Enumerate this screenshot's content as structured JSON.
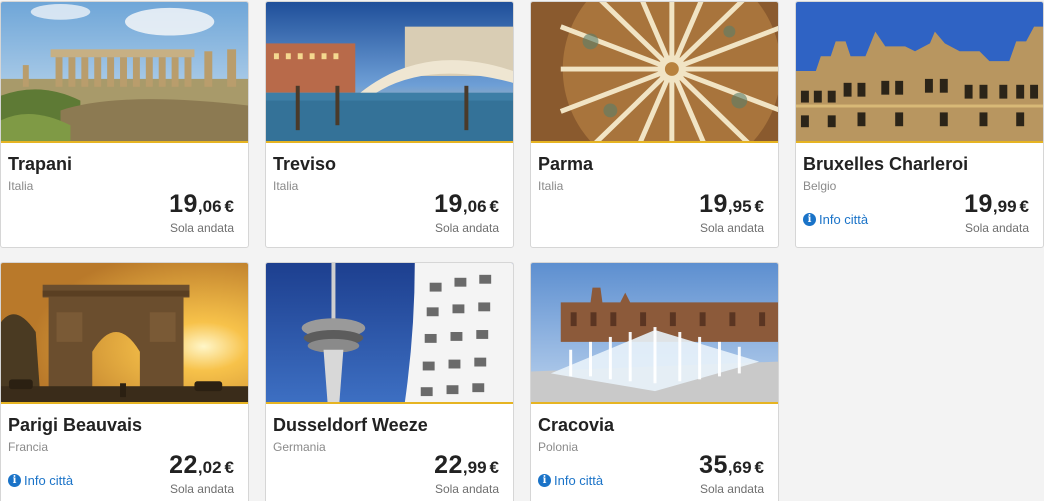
{
  "destinations": [
    {
      "city": "Trapani",
      "country": "Italia",
      "price_int": "19",
      "price_dec": ",06",
      "currency": "€",
      "fare_type": "Sola andata",
      "info": ""
    },
    {
      "city": "Treviso",
      "country": "Italia",
      "price_int": "19",
      "price_dec": ",06",
      "currency": "€",
      "fare_type": "Sola andata",
      "info": ""
    },
    {
      "city": "Parma",
      "country": "Italia",
      "price_int": "19",
      "price_dec": ",95",
      "currency": "€",
      "fare_type": "Sola andata",
      "info": ""
    },
    {
      "city": "Bruxelles Charleroi",
      "country": "Belgio",
      "price_int": "19",
      "price_dec": ",99",
      "currency": "€",
      "fare_type": "Sola andata",
      "info": "Info città"
    },
    {
      "city": "Parigi Beauvais",
      "country": "Francia",
      "price_int": "22",
      "price_dec": ",02",
      "currency": "€",
      "fare_type": "Sola andata",
      "info": "Info città"
    },
    {
      "city": "Dusseldorf Weeze",
      "country": "Germania",
      "price_int": "22",
      "price_dec": ",99",
      "currency": "€",
      "fare_type": "Sola andata",
      "info": ""
    },
    {
      "city": "Cracovia",
      "country": "Polonia",
      "price_int": "35",
      "price_dec": ",69",
      "currency": "€",
      "fare_type": "Sola andata",
      "info": "Info città"
    }
  ],
  "icons": {
    "info": "info-circle-icon"
  },
  "colors": {
    "accent_bar": "#e6b422",
    "link": "#1a73c8",
    "background": "#f3f3f3"
  }
}
